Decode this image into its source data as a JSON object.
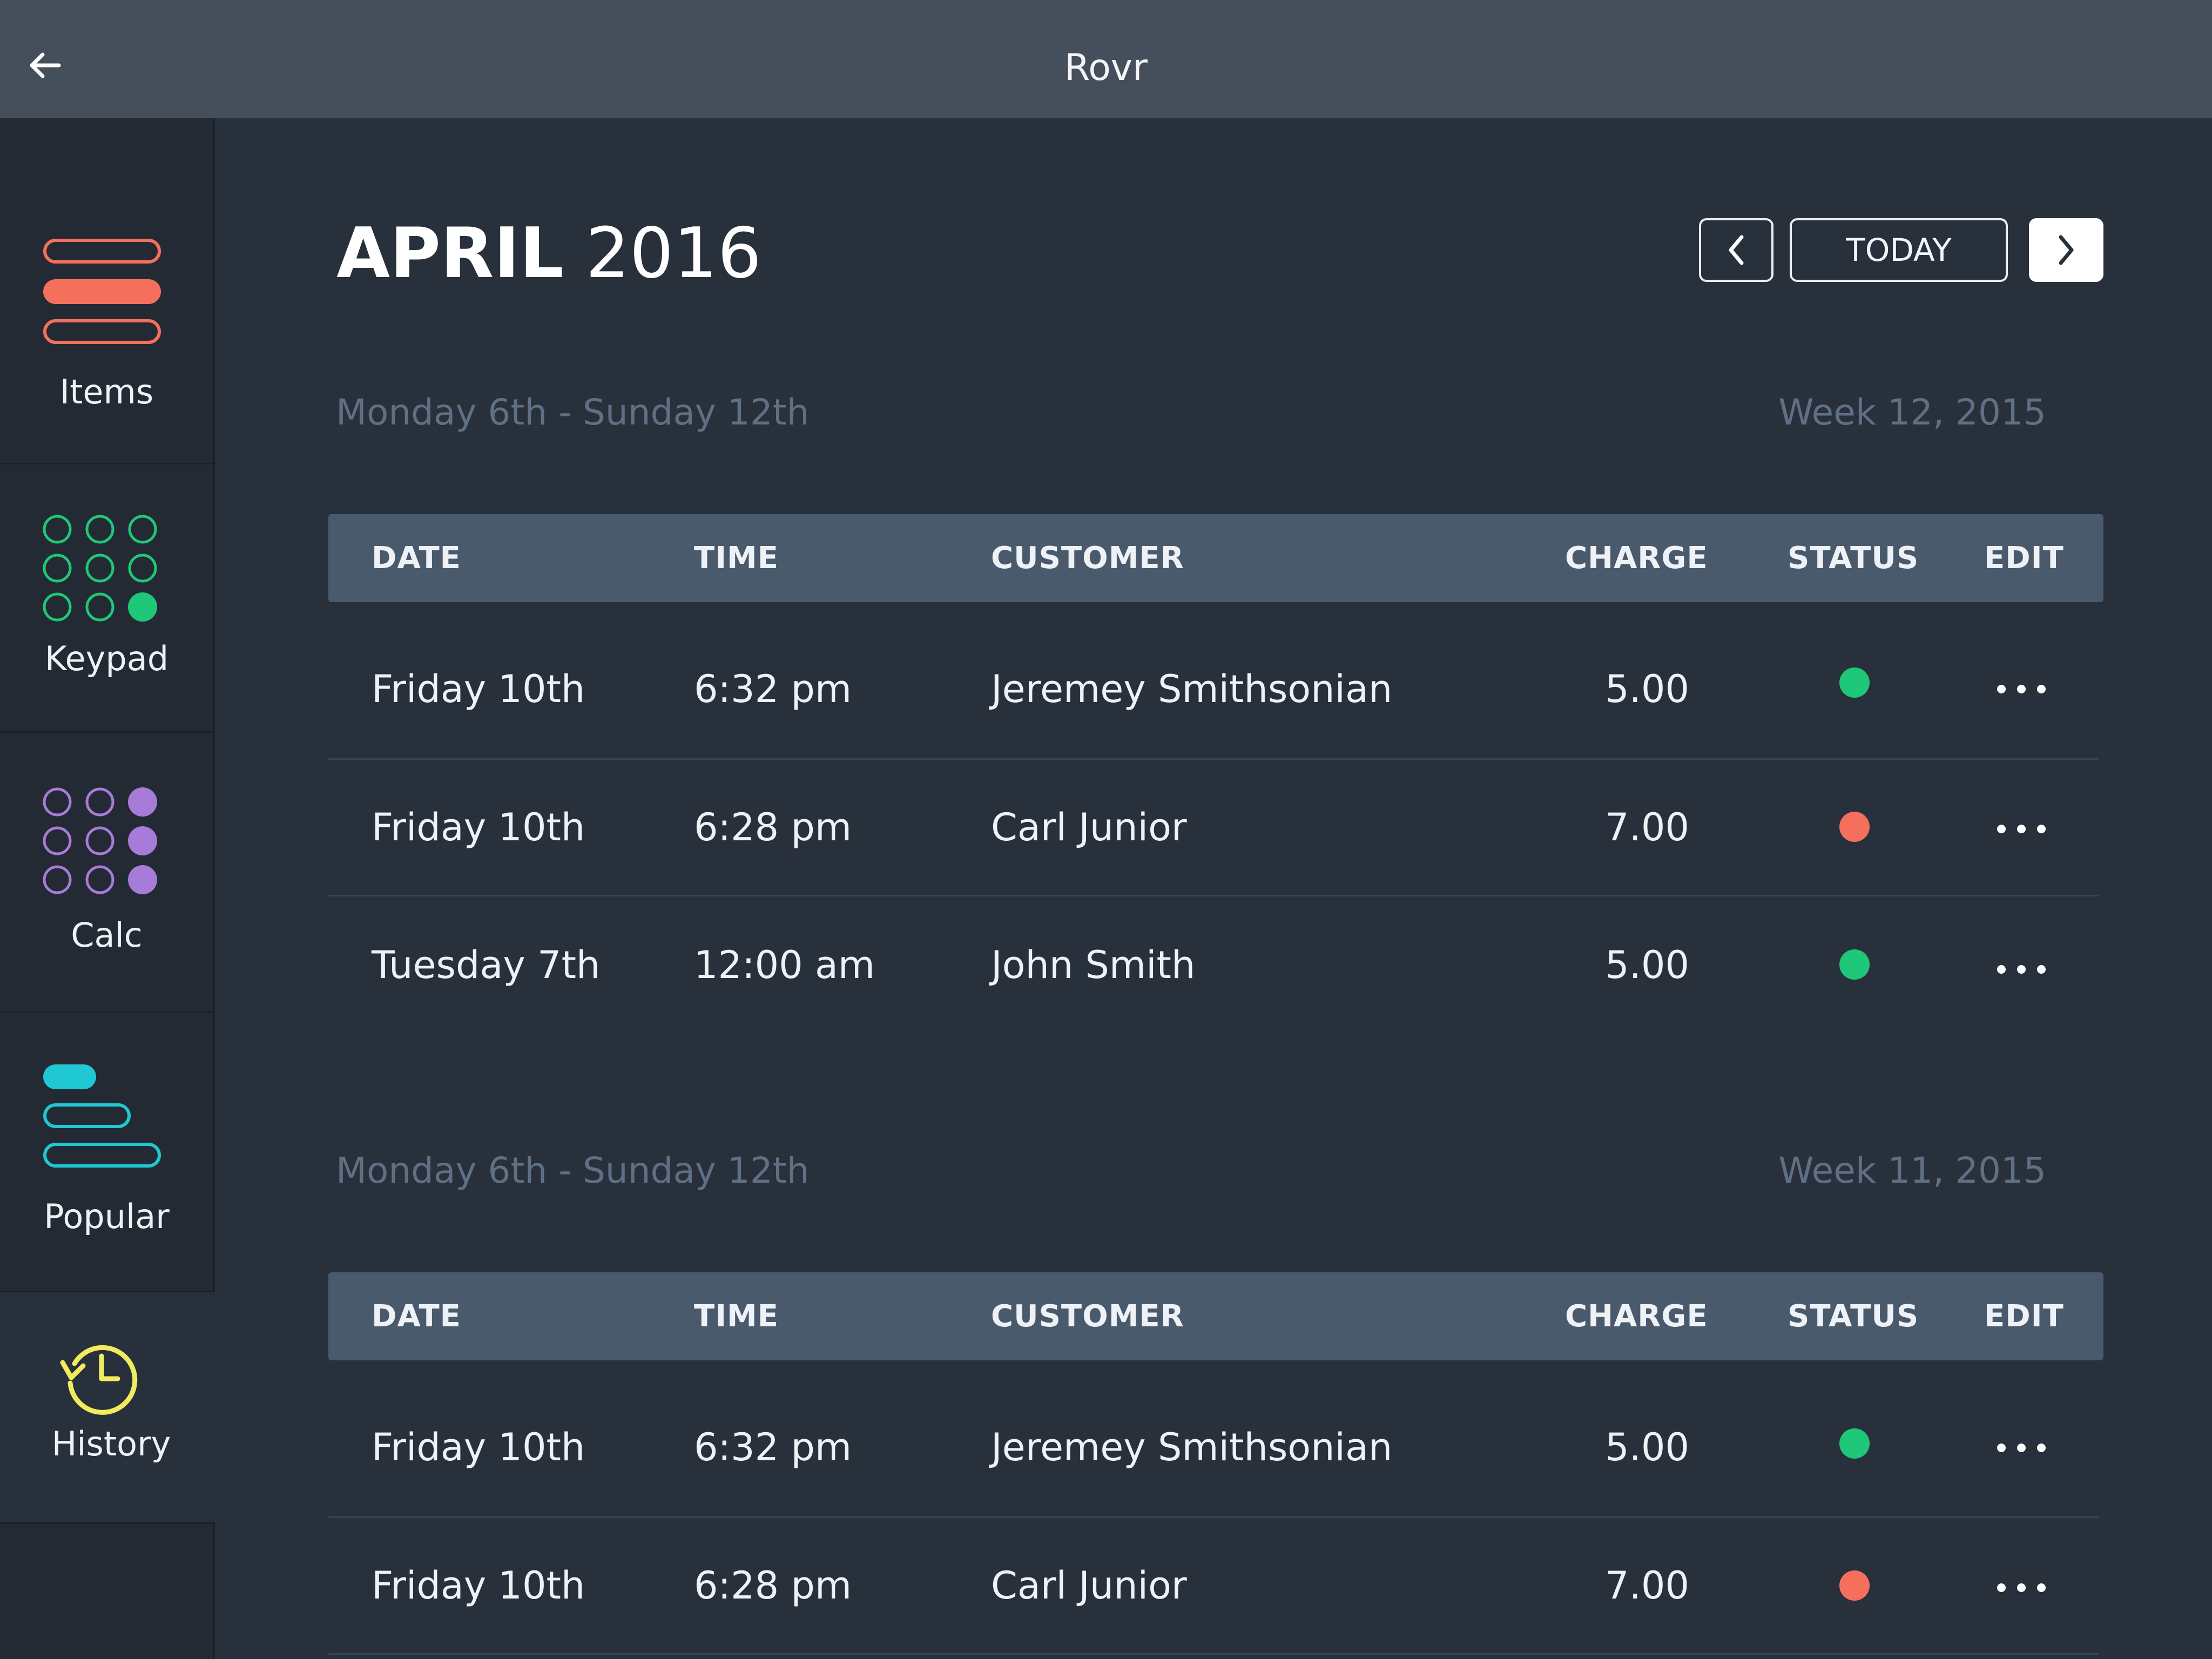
{
  "app": {
    "title": "Rovr"
  },
  "sidebar": {
    "items": [
      {
        "label": "Items",
        "icon": "list-lines-icon",
        "color": "#f5705c"
      },
      {
        "label": "Keypad",
        "icon": "keypad-grid-icon",
        "color": "#1fc778"
      },
      {
        "label": "Calc",
        "icon": "calculator-grid-icon",
        "color": "#a77bd8"
      },
      {
        "label": "Popular",
        "icon": "popular-bars-icon",
        "color": "#1fc8d2"
      },
      {
        "label": "History",
        "icon": "history-clock-icon",
        "color": "#f1ec5e",
        "active": true
      }
    ]
  },
  "header": {
    "month": "APRIL",
    "year": "2016",
    "today_label": "TODAY",
    "prev_icon": "chevron-left-icon",
    "next_icon": "chevron-right-icon"
  },
  "columns": {
    "date": "DATE",
    "time": "TIME",
    "customer": "CUSTOMER",
    "charge": "CHARGE",
    "status": "STATUS",
    "edit": "EDIT"
  },
  "status_colors": {
    "ok": "#1fc778",
    "error": "#f5705c"
  },
  "weeks": [
    {
      "range": "Monday 6th - Sunday 12th",
      "label": "Week 12, 2015",
      "rows": [
        {
          "date": "Friday 10th",
          "time": "6:32 pm",
          "customer": "Jeremey Smithsonian",
          "charge": "5.00",
          "status": "ok"
        },
        {
          "date": "Friday 10th",
          "time": "6:28 pm",
          "customer": "Carl Junior",
          "charge": "7.00",
          "status": "error"
        },
        {
          "date": "Tuesday 7th",
          "time": "12:00 am",
          "customer": "John Smith",
          "charge": "5.00",
          "status": "ok"
        }
      ]
    },
    {
      "range": "Monday 6th - Sunday 12th",
      "label": "Week 11, 2015",
      "rows": [
        {
          "date": "Friday 10th",
          "time": "6:32 pm",
          "customer": "Jeremey Smithsonian",
          "charge": "5.00",
          "status": "ok"
        },
        {
          "date": "Friday 10th",
          "time": "6:28 pm",
          "customer": "Carl Junior",
          "charge": "7.00",
          "status": "error"
        }
      ]
    }
  ]
}
